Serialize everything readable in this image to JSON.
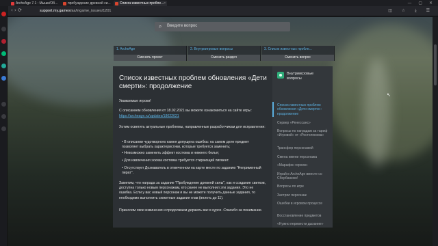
{
  "browser": {
    "tabs": [
      {
        "label": "ArcheAge 7.1 : Мыши/Об..."
      },
      {
        "label": "пробуждение древней си..."
      },
      {
        "label": "Список известных пробле..."
      }
    ],
    "window_controls": "— ▢ ✕",
    "nav_glyphs": "‹ › ⟳",
    "url_host": "support.my.games",
    "url_path": "/aa/ingame_issues/1201",
    "toolbar_glyphs": "◫ ☆ ⤓ ☰"
  },
  "colors": {
    "accent": "#5bb0e0",
    "brand": "#2fae7a"
  },
  "search": {
    "placeholder": "Введите вопрос",
    "icon": "search-icon"
  },
  "steps": [
    {
      "title": "1. ArcheAge",
      "button": "Сменить проект"
    },
    {
      "title": "2. Внутриигровые вопросы",
      "button": "Сменить раздел"
    },
    {
      "title": "3. Список известных пробле...",
      "button": "Сменить вопрос"
    }
  ],
  "article": {
    "title": "Список известных проблем обновления «Дети смерти»: продолжение",
    "greeting": "Уважаемые игроки!",
    "intro": "С описанием обновления от 18.02.2021 вы можете ознакомиться на сайте игры:",
    "link": "https://archeage.ru/updates/18022021",
    "issues_header": "Хотим осветить актуальные проблемы, направленные разработчикам для исправления:",
    "bullets": [
      "В описании чудотворного камня допущена ошибка: на самом деле предмет позволяет выбрать характеристики, которые требуется заменить;",
      "Невозможно заменить эффект костюма и нижнего белья;",
      "Для извлечения эскиза костюма требуется стирающий пигмент.",
      "Отсутствует Дознаватель в отмеченном на карте месте по заданию \"Неприменный пират\"."
    ],
    "note": "Заметим, что награда за задание \"Пробуждение древней силы\", как и создание свитков, доступна только новым персонажам, кто ранее не выполнил эти задания. Это не ошибка. Если у вас новый персонаж и вы не можете получить данные задания, то необходимо выполнить сюжетные задания глав (вплоть до 11).",
    "apology": "Приносим свои извинения и продолжаем держать вас в курсе. Спасибо за понимание."
  },
  "rail": {
    "title": "Внутриигровые вопросы",
    "items": [
      {
        "label": "Список известных проблем обновления «Дети смерти»: продолжение",
        "active": true
      },
      {
        "label": "Сервер «Ренессанс»"
      },
      {
        "label": "Вопросы по наградам за тариф «Игровой» от «Ростелекома»"
      },
      {
        "label": "Трансфер персонажей"
      },
      {
        "label": "Смена имени персонажа"
      },
      {
        "label": "«Марафон героев»"
      },
      {
        "label": "Играй в ArcheAge вместе со Сбербанком!"
      },
      {
        "label": "Вопросы по игре"
      },
      {
        "label": "Застрял персонаж"
      },
      {
        "label": "Ошибки в игровом процессе"
      },
      {
        "label": "Восстановление предметов"
      },
      {
        "label": "«Нужно перевести дыхание»"
      }
    ]
  }
}
